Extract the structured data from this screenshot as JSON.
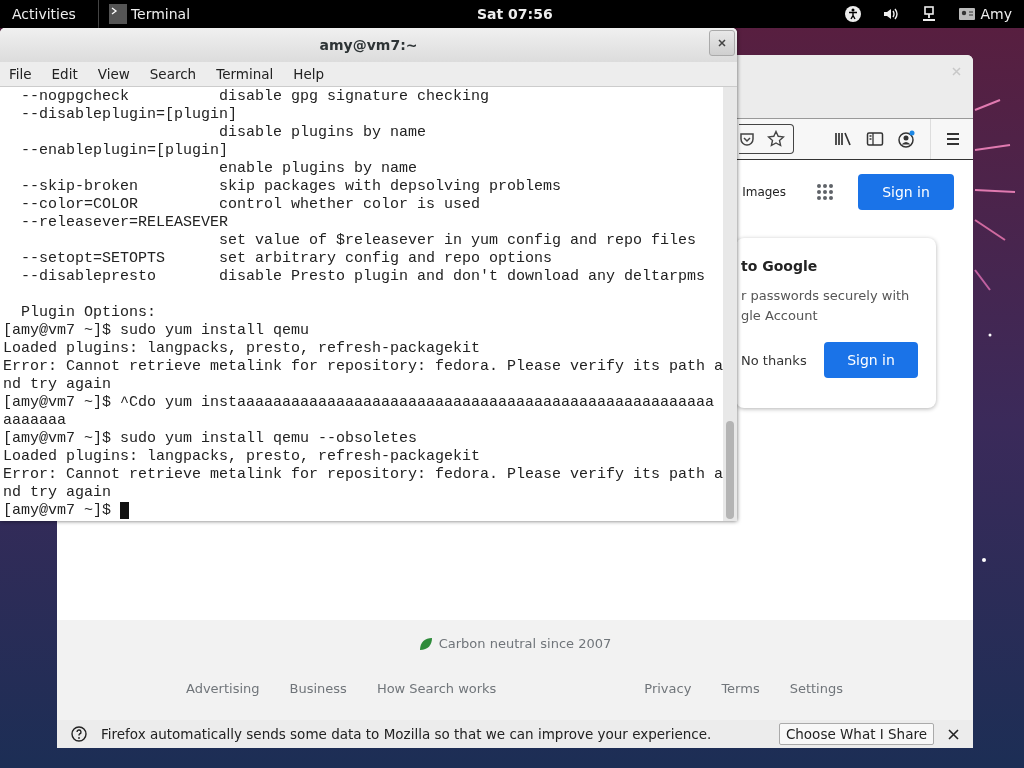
{
  "top_bar": {
    "activities": "Activities",
    "app": "Terminal",
    "clock": "Sat 07:56",
    "user": "Amy"
  },
  "browser": {
    "header_link": "Images",
    "sign_in": "Sign in",
    "card": {
      "title": "to Google",
      "lines": [
        "r passwords securely with",
        "gle Account"
      ],
      "dismiss": "No thanks",
      "confirm": "Sign in"
    },
    "carbon": "Carbon neutral since 2007",
    "footer_left": [
      "Advertising",
      "Business",
      "How Search works"
    ],
    "footer_right": [
      "Privacy",
      "Terms",
      "Settings"
    ],
    "notification": {
      "text": "Firefox automatically sends some data to Mozilla so that we can improve your experience.",
      "button": "Choose What I Share"
    }
  },
  "terminal": {
    "title": "amy@vm7:~",
    "menu": [
      "File",
      "Edit",
      "View",
      "Search",
      "Terminal",
      "Help"
    ],
    "blocks": [
      [
        "  --nogpgcheck          disable gpg signature checking",
        "  --disableplugin=[plugin]",
        "                        disable plugins by name",
        "  --enableplugin=[plugin]",
        "                        enable plugins by name",
        "  --skip-broken         skip packages with depsolving problems",
        "  --color=COLOR         control whether color is used",
        "  --releasever=RELEASEVER",
        "                        set value of $releasever in yum config and repo files",
        "  --setopt=SETOPTS      set arbitrary config and repo options",
        "  --disablepresto       disable Presto plugin and don't download any deltarpms"
      ],
      [
        "  Plugin Options:",
        "[amy@vm7 ~]$ sudo yum install qemu",
        "Loaded plugins: langpacks, presto, refresh-packagekit",
        "Error: Cannot retrieve metalink for repository: fedora. Please verify its path a",
        "nd try again",
        "[amy@vm7 ~]$ ^Cdo yum instaaaaaaaaaaaaaaaaaaaaaaaaaaaaaaaaaaaaaaaaaaaaaaaaaaaaa",
        "aaaaaaa",
        "[amy@vm7 ~]$ sudo yum install qemu --obsoletes",
        "Loaded plugins: langpacks, presto, refresh-packagekit",
        "Error: Cannot retrieve metalink for repository: fedora. Please verify its path a",
        "nd try again",
        "[amy@vm7 ~]$ "
      ]
    ]
  }
}
